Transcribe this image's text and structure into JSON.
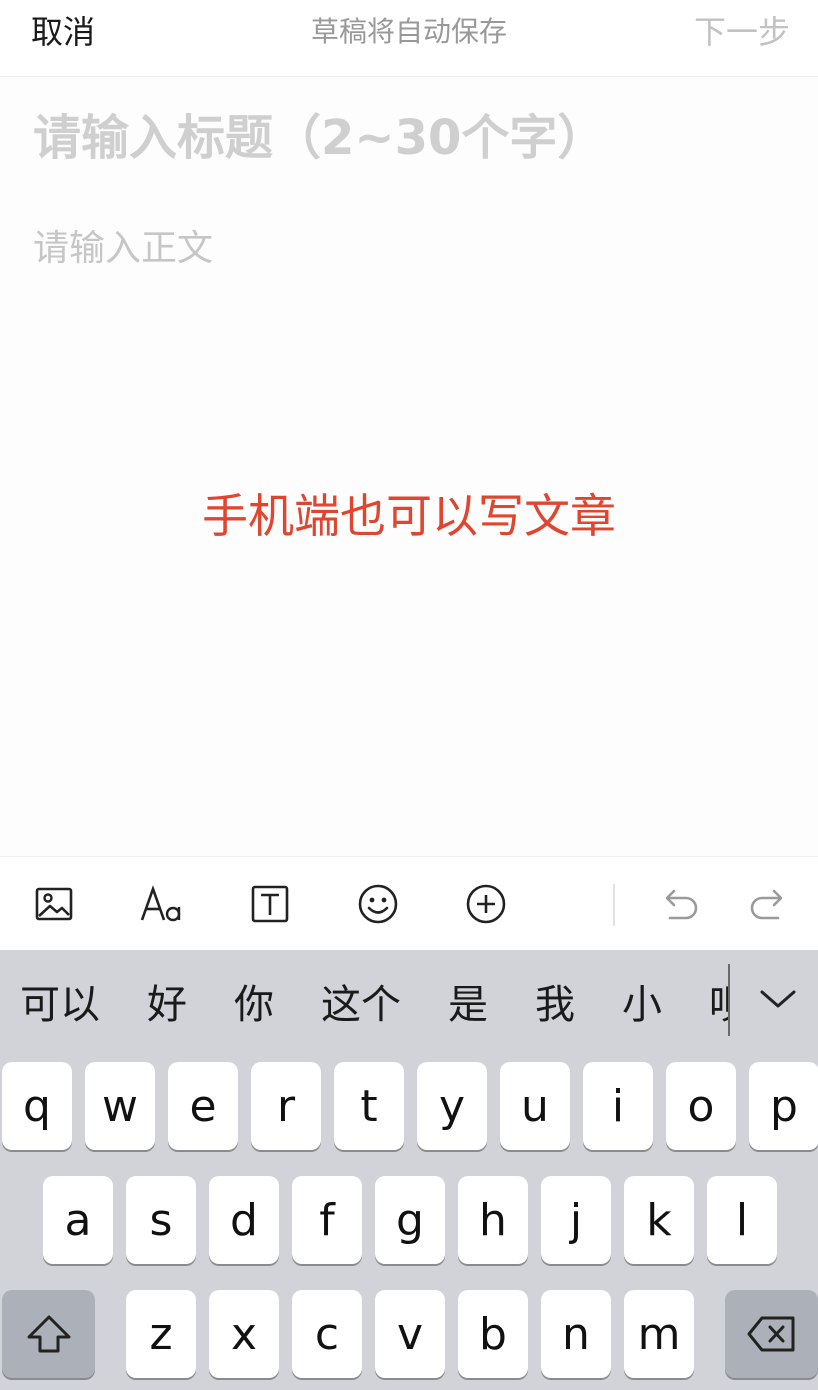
{
  "header": {
    "cancel_label": "取消",
    "status_text": "草稿将自动保存",
    "next_label": "下一步"
  },
  "editor": {
    "title_placeholder": "请输入标题（2~30个字）",
    "body_placeholder": "请输入正文",
    "annotation_text": "手机端也可以写文章"
  },
  "toolbar": {
    "icons": [
      "image-icon",
      "text-format-icon",
      "text-box-icon",
      "emoji-icon",
      "add-icon",
      "undo-icon",
      "redo-icon"
    ]
  },
  "keyboard": {
    "candidates": [
      "可以",
      "好",
      "你",
      "这个",
      "是",
      "我",
      "小",
      "呗"
    ],
    "row1": [
      "q",
      "w",
      "e",
      "r",
      "t",
      "y",
      "u",
      "i",
      "o",
      "p"
    ],
    "row2": [
      "a",
      "s",
      "d",
      "f",
      "g",
      "h",
      "j",
      "k",
      "l"
    ],
    "row3": [
      "z",
      "x",
      "c",
      "v",
      "b",
      "n",
      "m"
    ]
  },
  "colors": {
    "annotation": "#e0452f",
    "keyboard_bg": "#d1d3d9",
    "key_dark": "#acb0b9"
  }
}
